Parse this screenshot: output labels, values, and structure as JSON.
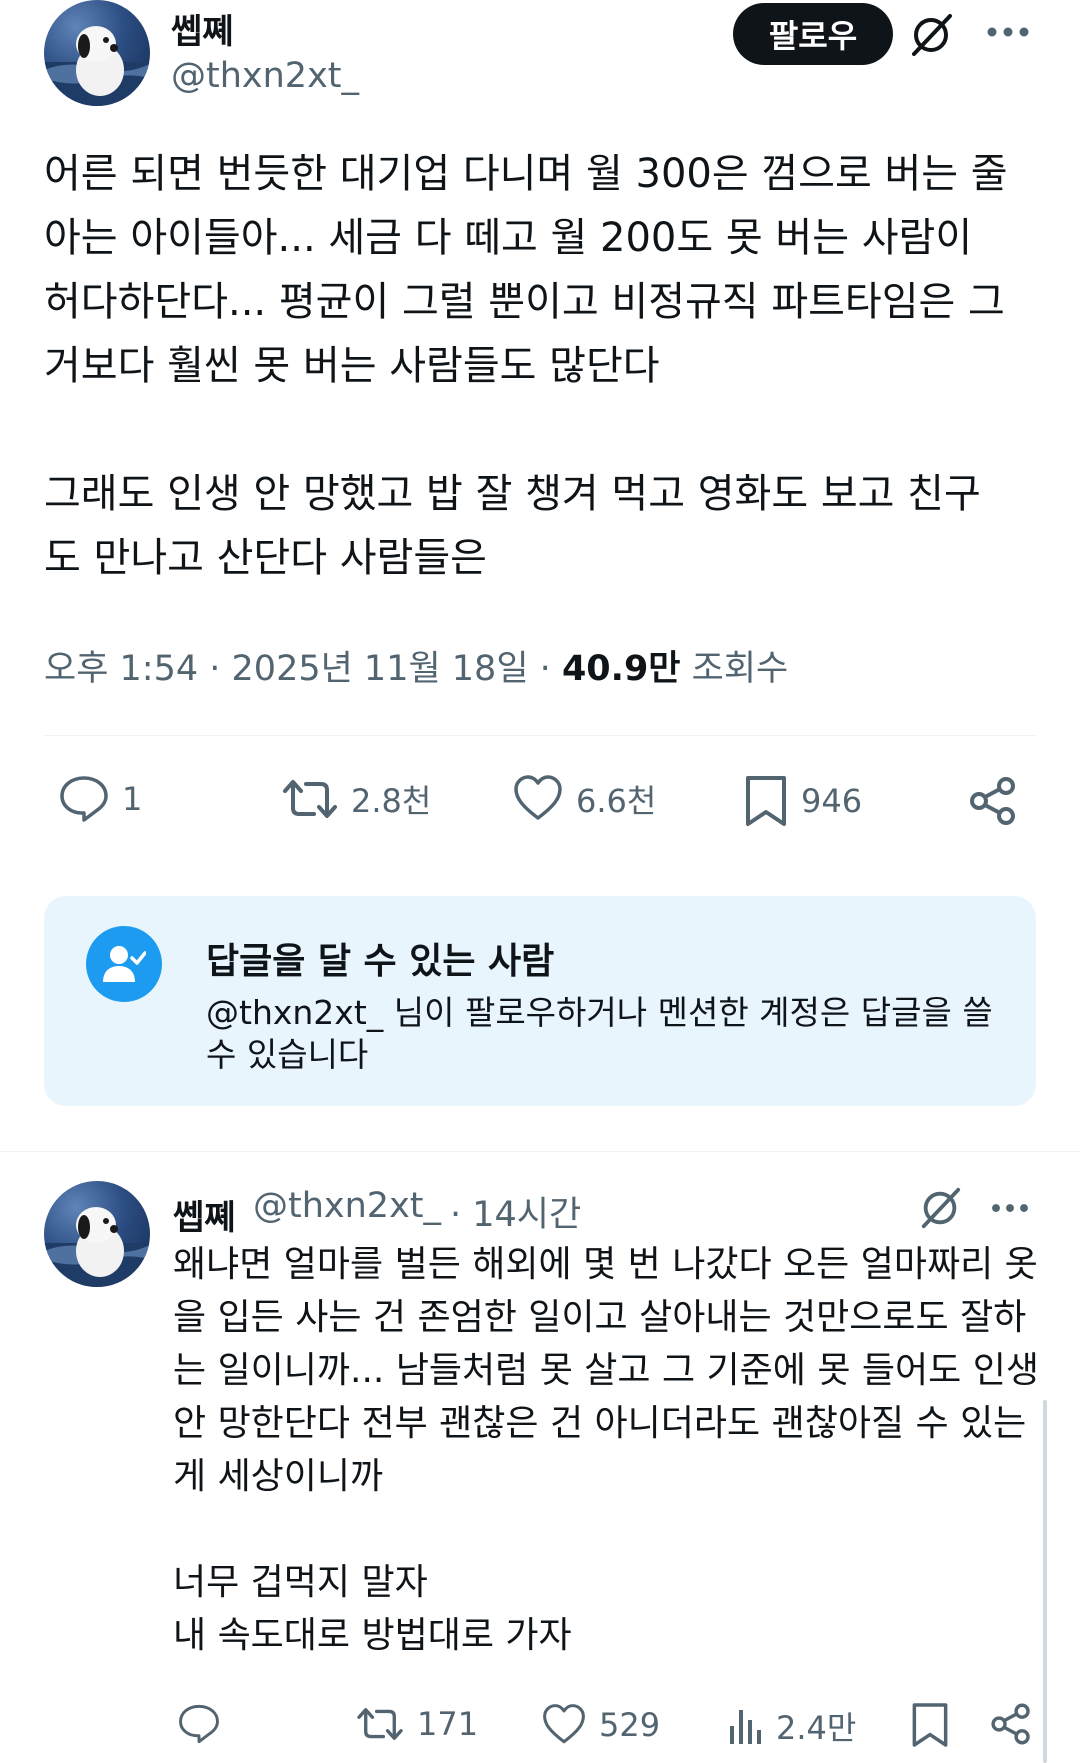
{
  "post": {
    "author_name": "쎕쪠",
    "author_handle": "@thxn2xt_",
    "follow_label": "팔로우",
    "text": "어른 되면 번듯한 대기업 다니며 월 300은 껌으로 버는 줄\n아는 아이들아... 세금 다 떼고 월 200도 못 버는 사람이\n허다하단다... 평균이 그럴 뿐이고 비정규직 파트타임은 그\n거보다 훨씬 못 버는 사람들도 많단다\n\n그래도 인생 안 망했고 밥 잘 챙겨 먹고 영화도 보고 친구\n도 만나고 산단다 사람들은",
    "time": "오후 1:54",
    "date": "2025년 11월 18일",
    "views_count": "40.9만",
    "views_label": "조회수",
    "stats": {
      "replies": "1",
      "reposts": "2.8천",
      "likes": "6.6천",
      "bookmarks": "946"
    }
  },
  "reply_restriction": {
    "title": "답글을 달 수 있는 사람",
    "description": "@thxn2xt_ 님이 팔로우하거나 멘션한 계정은 답글을 쓸 수 있습니다"
  },
  "reply": {
    "author_name": "쎕쪠",
    "author_handle": "@thxn2xt_",
    "time_ago": "· 14시간",
    "text": "왜냐면 얼마를 벌든 해외에 몇 번 나갔다 오든 얼마짜리 옷\n을 입든 사는 건 존엄한 일이고 살아내는 것만으로도 잘하\n는 일이니까... 남들처럼 못 살고 그 기준에 못 들어도 인생\n안 망한단다 전부 괜찮은 건 아니더라도 괜찮아질 수 있는\n게 세상이니까\n\n너무 겁먹지 말자\n내 속도대로 방법대로 가자",
    "stats": {
      "reposts": "171",
      "likes": "529",
      "views": "2.4만"
    }
  },
  "colors": {
    "text": "#0f1419",
    "muted": "#536471",
    "accent": "#1d9bf0",
    "reply_box_bg": "#e8f5fd"
  },
  "icons": [
    "grok-icon",
    "more-icon",
    "reply-icon",
    "repost-icon",
    "like-icon",
    "bookmark-icon",
    "share-icon",
    "views-icon",
    "user-check-icon"
  ]
}
